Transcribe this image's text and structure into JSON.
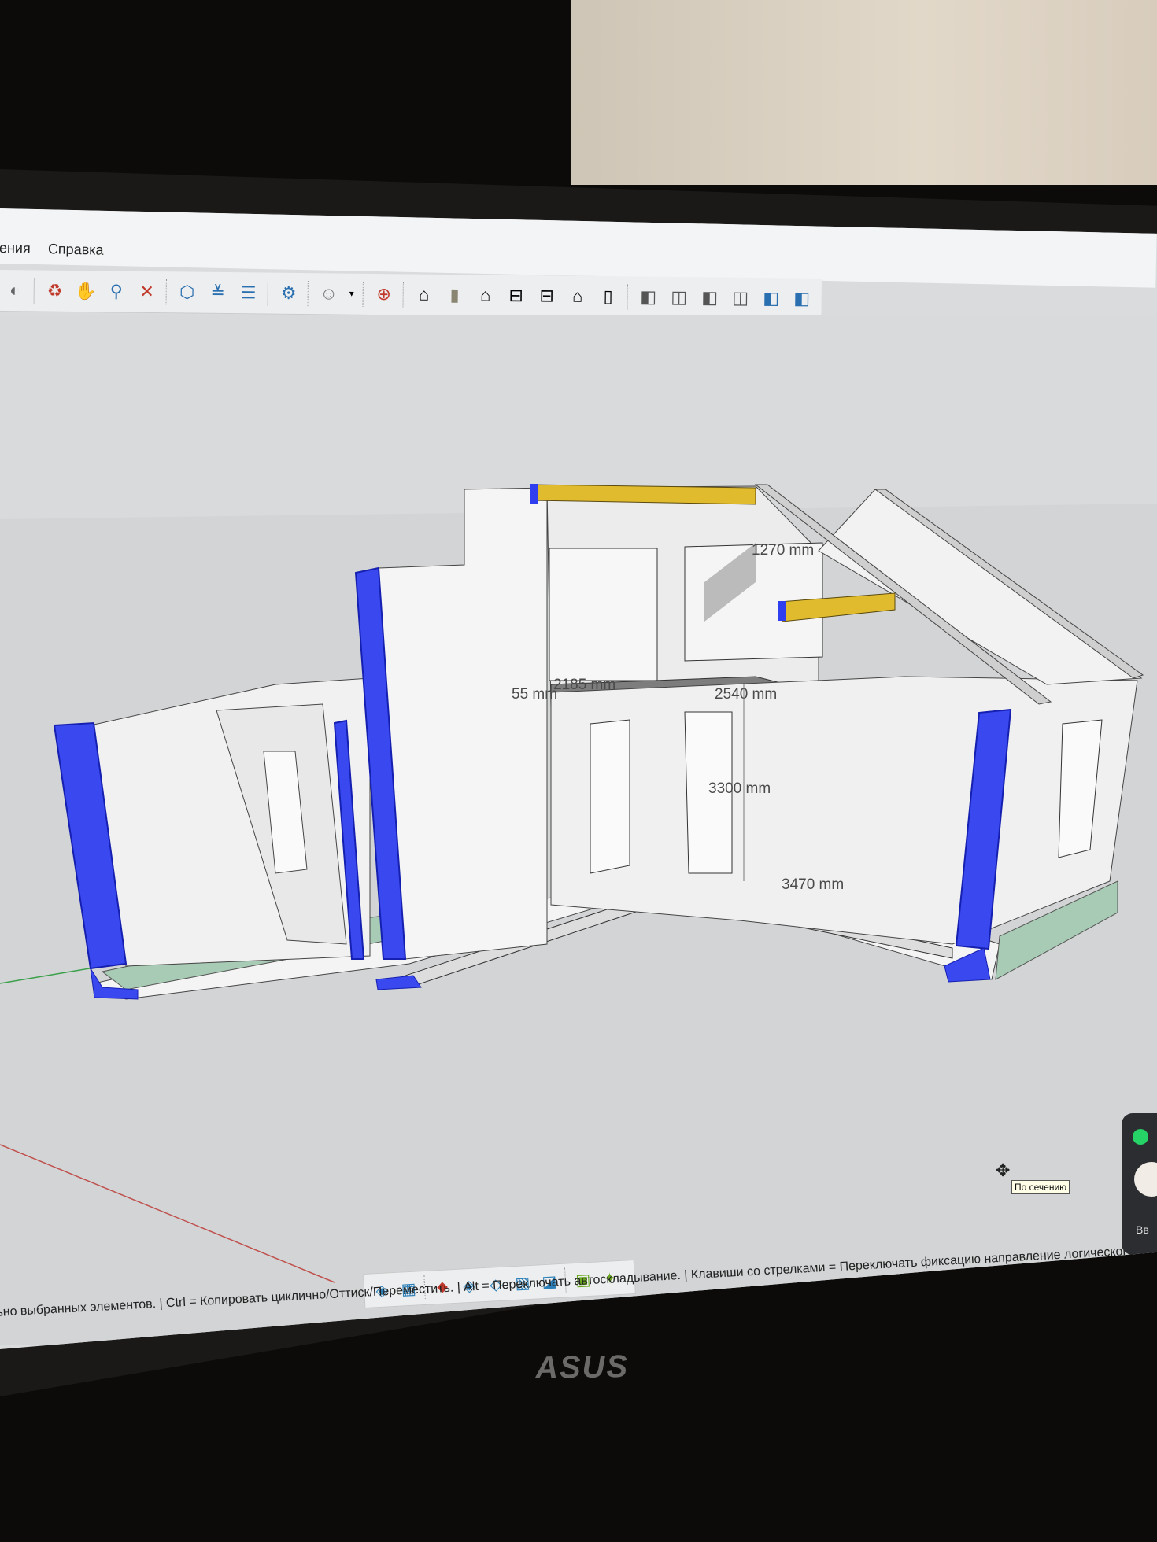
{
  "menu": {
    "items": [
      {
        "label": "ения"
      },
      {
        "label": "Справка"
      }
    ]
  },
  "toolbar": {
    "icons": [
      "orbit-partial-icon",
      "paint-bucket-icon",
      "hand-pan-icon",
      "zoom-icon",
      "zoom-extents-icon",
      "section-plane-icon",
      "section-fill-icon",
      "layers-icon",
      "section-settings-icon",
      "user-account-icon",
      "user-dropdown-icon",
      "geo-location-icon",
      "iso-view-icon",
      "top-view-icon",
      "front-view-icon",
      "right-view-icon",
      "back-view-icon",
      "left-view-icon",
      "bottom-view-icon",
      "xray-icon",
      "wireframe-icon",
      "hidden-line-icon",
      "shaded-icon",
      "shaded-textures-icon",
      "monochrome-icon"
    ]
  },
  "model": {
    "dimensions": [
      {
        "label": "1270 mm"
      },
      {
        "label": "2185 mm"
      },
      {
        "label": "55 mm"
      },
      {
        "label": "2540 mm"
      },
      {
        "label": "3300 mm"
      },
      {
        "label": "3470 mm"
      }
    ],
    "colors": {
      "selection": "#2f3ff0",
      "beam": "#e0bb2e",
      "wall": "#f2f2f2",
      "insulation": "#a7cbb4",
      "ground": "#d6d8d9"
    }
  },
  "tooltip": {
    "text": "По сечению"
  },
  "bottom_toolbar": {
    "icons": [
      "sandbox-from-contours-icon",
      "sandbox-from-scratch-icon",
      "smoove-icon",
      "stamp-icon",
      "drape-icon",
      "add-detail-icon",
      "flip-edge-icon",
      "extension-warehouse-icon",
      "extension-manager-icon"
    ]
  },
  "status_bar": {
    "text": "ьно выбранных элементов. | Ctrl = Копировать циклично/Оттиск/Переместить. | Alt = Переключать автоскладывание. | Клавиши со стрелками = Переключать фиксацию направление логического вы"
  },
  "whatsapp": {
    "partial_text": "Вв"
  },
  "monitor": {
    "brand": "ASUS"
  }
}
